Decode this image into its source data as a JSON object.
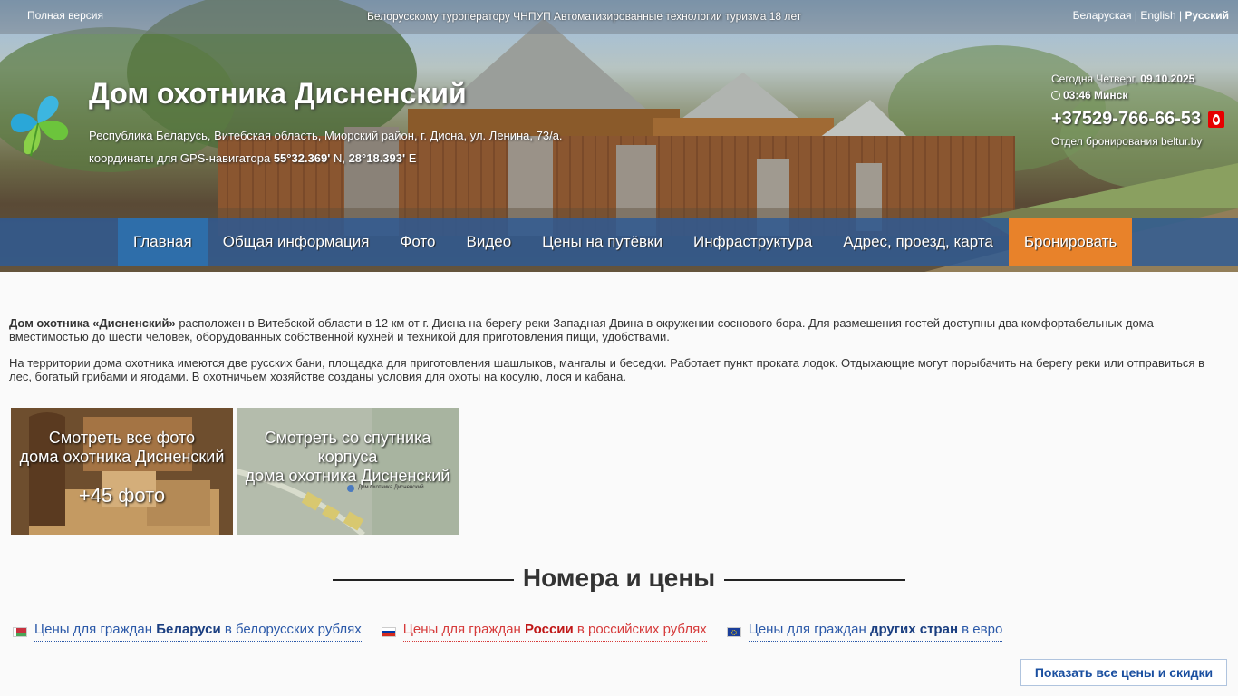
{
  "topbar": {
    "full_version": "Полная версия",
    "center_text": "Белорусскому туроператору ЧНПУП Автоматизированные технологии туризма 18 лет",
    "lang_by": "Беларуская",
    "lang_en": "English",
    "lang_ru": "Русский",
    "separator": "|"
  },
  "header": {
    "title": "Дом охотника Дисненский",
    "address": "Республика Беларусь, Витебская область, Миорский район, г. Дисна, ул. Ленина, 73/а.",
    "gps_prefix": "координаты для GPS-навигатора",
    "gps_lat": "55°32.369'",
    "gps_lat_dir": "N,",
    "gps_lon": "28°18.393'",
    "gps_lon_dir": "E"
  },
  "info": {
    "today_label": "Сегодня Четверг,",
    "today_date": "09.10.2025",
    "time": "03:46 Минск",
    "phone": "+37529-766-66-53",
    "booking_dept": "Отдел бронирования beltur.by"
  },
  "nav": {
    "items": [
      {
        "label": "Главная"
      },
      {
        "label": "Общая информация"
      },
      {
        "label": "Фото"
      },
      {
        "label": "Видео"
      },
      {
        "label": "Цены на путёвки"
      },
      {
        "label": "Инфраструктура"
      },
      {
        "label": "Адрес, проезд, карта"
      },
      {
        "label": "Бронировать"
      }
    ]
  },
  "intro": {
    "p1_bold": "Дом охотника «Дисненский»",
    "p1_text": " расположен в Витебской области в 12 км от г. Дисна на берегу реки Западная Двина в окружении соснового бора. Для размещения гостей доступны два комфортабельных дома вместимостью до шести человек, оборудованных собственной кухней и техникой для приготовления пищи, удобствами.",
    "p2_text": "На территории дома охотника имеются две русских бани, площадка для приготовления шашлыков, мангалы и беседки. Работает пункт проката лодок. Отдыхающие могут порыбачить на берегу реки или отправиться в лес, богатый грибами и ягодами. В охотничьем хозяйстве созданы условия для охоты на косулю, лося и кабана."
  },
  "tiles": {
    "photos_line1": "Смотреть все фото",
    "photos_line2": "дома охотника Дисненский",
    "photos_count": "+45 фото",
    "satellite_line1": "Смотреть со спутника",
    "satellite_line2": "корпуса",
    "satellite_line3": "дома охотника Дисненский",
    "map_label": "Дом охотника Дисненский"
  },
  "rooms": {
    "title": "Номера и цены",
    "by_pre": "Цены для граждан ",
    "by_bold": "Беларуси",
    "by_post": " в белорусских рублях",
    "ru_pre": "Цены для граждан ",
    "ru_bold": "России",
    "ru_post": " в российских рублях",
    "eu_pre": "Цены для граждан ",
    "eu_bold": "других стран",
    "eu_post": " в евро",
    "show_all": "Показать все цены и скидки"
  },
  "colors": {
    "nav_bg": "#2d5a96",
    "nav_active": "#2e6eaa",
    "book_btn": "#e8822a",
    "link_blue": "#2a58a8",
    "link_red": "#d63a3a"
  }
}
